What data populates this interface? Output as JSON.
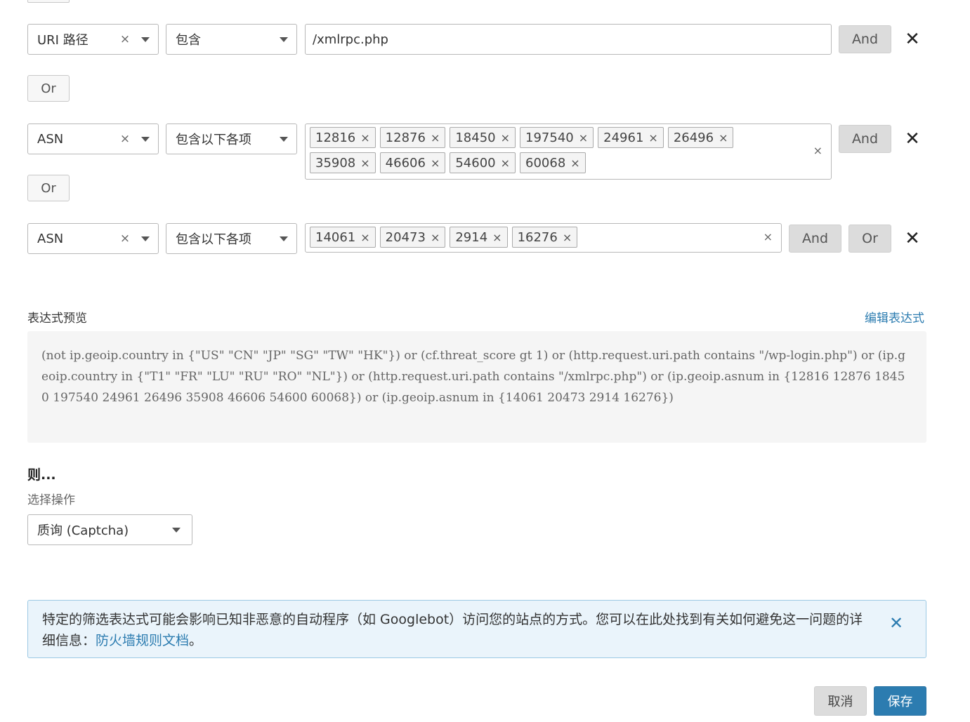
{
  "rows": [
    {
      "field": "URI 路径",
      "operator": "包含",
      "value": "/xmlrpc.php",
      "and_label": "And"
    },
    {
      "field": "ASN",
      "operator": "包含以下各项",
      "tags": [
        "12816",
        "12876",
        "18450",
        "197540",
        "24961",
        "26496",
        "35908",
        "46606",
        "54600",
        "60068"
      ],
      "and_label": "And"
    },
    {
      "field": "ASN",
      "operator": "包含以下各项",
      "tags": [
        "14061",
        "20473",
        "2914",
        "16276"
      ],
      "and_label": "And",
      "or_label": "Or"
    }
  ],
  "or_label": "Or",
  "clear_glyph": "×",
  "remove_glyph": "✕",
  "preview": {
    "title": "表达式预览",
    "edit_link": "编辑表达式",
    "expression": "(not ip.geoip.country in {\"US\" \"CN\" \"JP\" \"SG\" \"TW\" \"HK\"}) or (cf.threat_score gt 1) or (http.request.uri.path contains \"/wp-login.php\") or (ip.geoip.country in {\"T1\" \"FR\" \"LU\" \"RU\" \"RO\" \"NL\"}) or (http.request.uri.path contains \"/xmlrpc.php\") or (ip.geoip.asnum in {12816 12876 18450 197540 24961 26496 35908 46606 54600 60068}) or (ip.geoip.asnum in {14061 20473 2914 16276})"
  },
  "then": {
    "title": "则...",
    "subtitle": "选择操作",
    "action": "质询 (Captcha)"
  },
  "notice": {
    "text": "特定的筛选表达式可能会影响已知非恶意的自动程序（如 Googlebot）访问您的站点的方式。您可以在此处找到有关如何避免这一问题的详细信息：",
    "link": "防火墙规则文档",
    "suffix": "。"
  },
  "footer": {
    "cancel": "取消",
    "save": "保存"
  }
}
